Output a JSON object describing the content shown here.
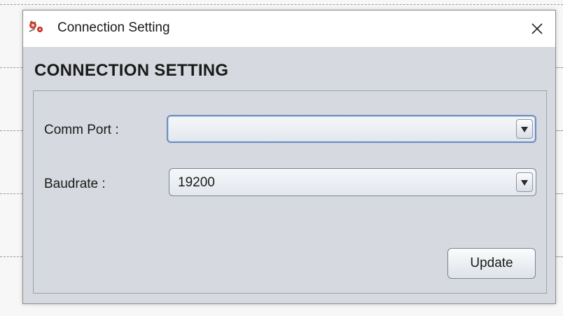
{
  "window": {
    "title": "Connection Setting",
    "icon": "connection-app-icon",
    "close_icon": "close-icon"
  },
  "heading": "CONNECTION SETTING",
  "fields": {
    "comm_port": {
      "label": "Comm Port :",
      "value": ""
    },
    "baudrate": {
      "label": "Baudrate :",
      "value": "19200"
    }
  },
  "buttons": {
    "update_label": "Update"
  },
  "colors": {
    "window_body": "#d6d9df",
    "titlebar": "#ffffff",
    "focus_border": "#6c8fbf"
  }
}
